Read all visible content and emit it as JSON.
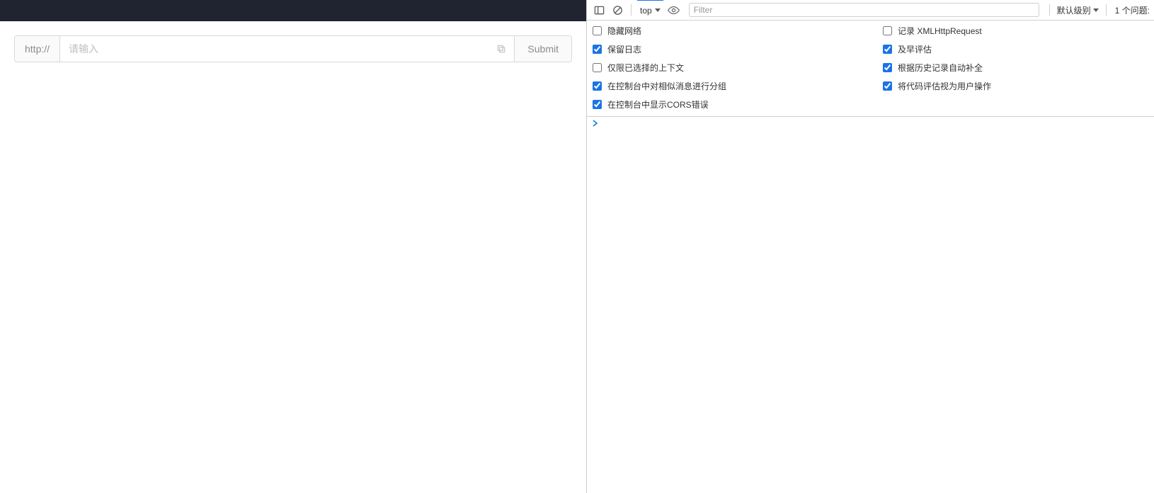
{
  "page": {
    "url_prefix": "http://",
    "url_placeholder": "请输入",
    "submit_label": "Submit"
  },
  "devtools": {
    "context_label": "top",
    "filter_placeholder": "Filter",
    "level_label": "默认级别",
    "issues_label": "1 个问题:",
    "settings": {
      "left": [
        {
          "label": "隐藏网络",
          "checked": false
        },
        {
          "label": "保留日志",
          "checked": true
        },
        {
          "label": "仅限已选择的上下文",
          "checked": false
        },
        {
          "label": "在控制台中对相似消息进行分组",
          "checked": true
        },
        {
          "label": "在控制台中显示CORS错误",
          "checked": true
        }
      ],
      "right": [
        {
          "label": "记录 XMLHttpRequest",
          "checked": false
        },
        {
          "label": "及早评估",
          "checked": true
        },
        {
          "label": "根据历史记录自动补全",
          "checked": true
        },
        {
          "label": "将代码评估视为用户操作",
          "checked": true
        }
      ]
    }
  }
}
